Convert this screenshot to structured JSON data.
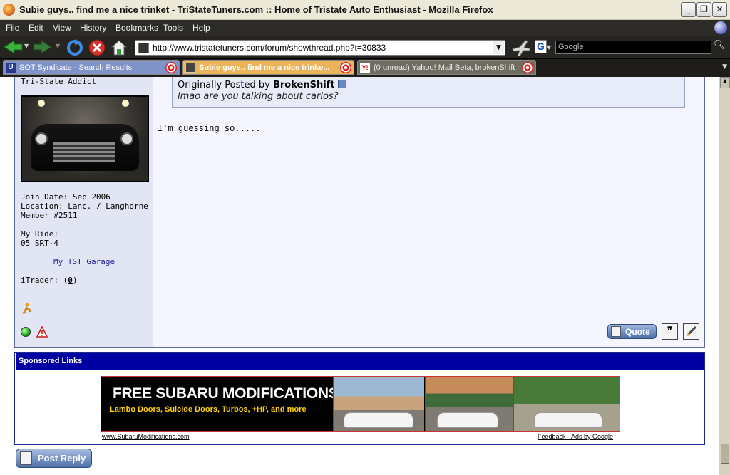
{
  "window": {
    "title": "Subie guys.. find me a nice trinket - TriStateTuners.com :: Home of Tristate Auto Enthusiast - Mozilla Firefox",
    "min_glyph": "_",
    "max_glyph": "❐",
    "close_glyph": "✕"
  },
  "menu": [
    "File",
    "Edit",
    "View",
    "History",
    "Bookmarks",
    "Tools",
    "Help"
  ],
  "toolbar": {
    "url": "http://www.tristatetuners.com/forum/showthread.php?t=30833",
    "search_placeholder": "Google",
    "search_engine_glyph": "G"
  },
  "tabs": [
    {
      "label": "SOT Syndicate - Search Results",
      "favicon_text": "U"
    },
    {
      "label": "Subie guys.. find me a nice trinke...",
      "favicon_text": ""
    },
    {
      "label": "(0 unread) Yahoo! Mail Beta, brokenShift",
      "favicon_text": "Y!"
    }
  ],
  "user": {
    "title": "Tri-State Addict",
    "join_date": "Join Date: Sep 2006",
    "location": "Location: Lanc. / Langhorne",
    "member_no": "Member #2511",
    "ride_label": "My Ride:",
    "ride": "05 SRT-4",
    "garage_link": "My TST Garage",
    "itrader_label": "iTrader: (",
    "itrader_value": "0",
    "itrader_close": ")"
  },
  "post": {
    "quote_prefix": "Originally Posted by",
    "quote_author": "BrokenShift",
    "quote_text": "lmao are you talking about carlos?",
    "message": "I'm guessing so.....",
    "quote_button": "Quote",
    "multiquote_glyph": "❞"
  },
  "sponsored": {
    "header": "Sponsored Links",
    "ad_headline": "FREE SUBARU MODIFICATIONS",
    "ad_subline": "Lambo Doors, Suicide Doors, Turbos, +HP, and more",
    "ad_url": "www.SubaruModifications.com",
    "ad_feedback": "Feedback - Ads by Google"
  },
  "reply": {
    "post_reply_button": "Post Reply"
  },
  "colors": {
    "accent_blue": "#0000a2",
    "panel": "#e2e5f3",
    "menubar": "#2c2b27",
    "active_tab": "#e9b45a"
  }
}
